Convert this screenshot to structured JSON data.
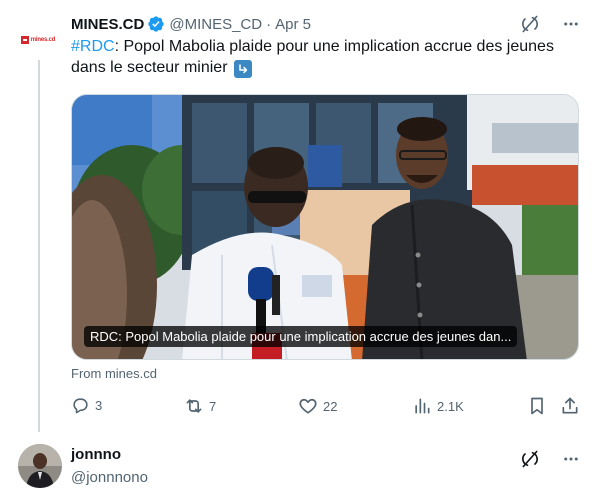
{
  "tweet": {
    "author_name": "MINES.CD",
    "author_handle": "@MINES_CD",
    "separator": "·",
    "date": "Apr 5",
    "avatar_logo_text": "mines.cd",
    "text_hashtag": "#RDC",
    "text_body": ": Popol Mabolia plaide pour une implication accrue des jeunes dans le secteur minier",
    "card": {
      "caption": "RDC: Popol Mabolia plaide pour une implication accrue des jeunes dan...",
      "source": "From mines.cd"
    },
    "actions": {
      "replies": "3",
      "retweets": "7",
      "likes": "22",
      "views": "2.1K"
    }
  },
  "reply": {
    "name": "jonnno",
    "handle": "@jonnnono"
  },
  "icons": {
    "verified": "verified-badge-icon",
    "grok": "grok-icon",
    "more": "more-dots-icon",
    "reply": "reply-icon",
    "retweet": "retweet-icon",
    "like": "heart-icon",
    "views": "views-chart-icon",
    "bookmark": "bookmark-icon",
    "share": "share-icon",
    "arrow_emoji": "arrow-down-right-emoji"
  },
  "colors": {
    "text": "#0f1419",
    "secondary": "#536471",
    "accent": "#1d9bf0",
    "border": "#cfd9de"
  }
}
